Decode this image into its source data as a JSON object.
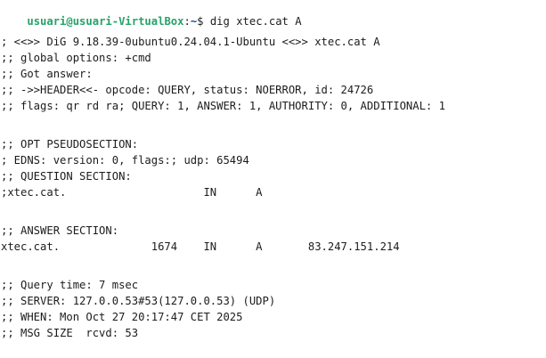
{
  "terminal": {
    "prompt": {
      "user_host": "usuari@usuari-VirtualBox",
      "separator": ":",
      "path": "~",
      "symbol": "$ ",
      "command": "dig xtec.cat A"
    },
    "output": [
      "",
      "; <<>> DiG 9.18.39-0ubuntu0.24.04.1-Ubuntu <<>> xtec.cat A",
      ";; global options: +cmd",
      ";; Got answer:",
      ";; ->>HEADER<<- opcode: QUERY, status: NOERROR, id: 24726",
      ";; flags: qr rd ra; QUERY: 1, ANSWER: 1, AUTHORITY: 0, ADDITIONAL: 1",
      "",
      ";; OPT PSEUDOSECTION:",
      "; EDNS: version: 0, flags:; udp: 65494",
      ";; QUESTION SECTION:",
      ";xtec.cat.                     IN      A",
      "",
      ";; ANSWER SECTION:",
      "xtec.cat.              1674    IN      A       83.247.151.214",
      "",
      ";; Query time: 7 msec",
      ";; SERVER: 127.0.0.53#53(127.0.0.53) (UDP)",
      ";; WHEN: Mon Oct 27 20:17:47 CET 2025",
      ";; MSG SIZE  rcvd: 53"
    ],
    "colors": {
      "background": "#ffffff",
      "text": "#1c1c1c",
      "prompt_user": "#26a269",
      "prompt_path": "#12488b"
    }
  }
}
